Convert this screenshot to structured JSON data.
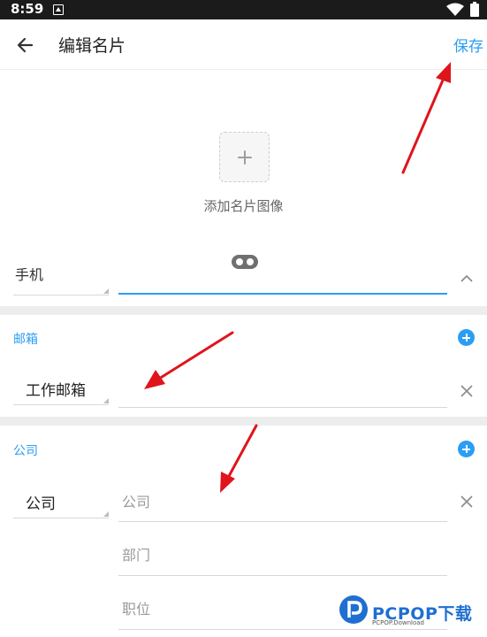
{
  "status_bar": {
    "time": "8:59"
  },
  "toolbar": {
    "title": "编辑名片",
    "save_label": "保存"
  },
  "avatar": {
    "label": "添加名片图像"
  },
  "phone": {
    "type": "手机"
  },
  "email": {
    "section_title": "邮箱",
    "type": "工作邮箱",
    "value": ""
  },
  "company": {
    "section_title": "公司",
    "type": "公司",
    "company_placeholder": "公司",
    "department_placeholder": "部门",
    "position_placeholder": "职位"
  },
  "watermark": {
    "brand": "PCPOP下载",
    "sub": "PCPOP.Download"
  },
  "colors": {
    "accent": "#2a9df4",
    "annotation": "#e0141b"
  }
}
